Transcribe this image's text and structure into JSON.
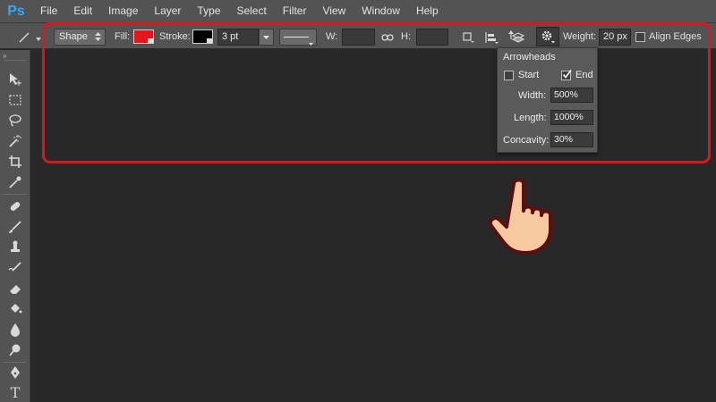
{
  "app": {
    "logo": "Ps"
  },
  "menu": [
    "File",
    "Edit",
    "Image",
    "Layer",
    "Type",
    "Select",
    "Filter",
    "View",
    "Window",
    "Help"
  ],
  "options": {
    "mode": "Shape",
    "fill_label": "Fill:",
    "fill_color": "#e3161b",
    "stroke_label": "Stroke:",
    "stroke_color": "#000000",
    "stroke_width": "3 pt",
    "w_label": "W:",
    "h_label": "H:",
    "weight_label": "Weight:",
    "weight_value": "20 px",
    "align_edges_label": "Align Edges",
    "align_edges_checked": false
  },
  "arrowheads": {
    "title": "Arrowheads",
    "start_label": "Start",
    "start_checked": false,
    "end_label": "End",
    "end_checked": true,
    "width_label": "Width:",
    "width_value": "500%",
    "length_label": "Length:",
    "length_value": "1000%",
    "concavity_label": "Concavity:",
    "concavity_value": "30%"
  },
  "colors": {
    "highlight": "#d9181e",
    "hand_fill": "#f6c9a0",
    "hand_outline": "#5a1010"
  },
  "tools": [
    "move-icon",
    "marquee-icon",
    "lasso-icon",
    "magic-wand-icon",
    "crop-icon",
    "eyedropper-icon",
    "healing-brush-icon",
    "brush-icon",
    "clone-stamp-icon",
    "history-brush-icon",
    "eraser-icon",
    "paint-bucket-icon",
    "blur-icon",
    "dodge-icon",
    "pen-icon",
    "type-icon"
  ]
}
